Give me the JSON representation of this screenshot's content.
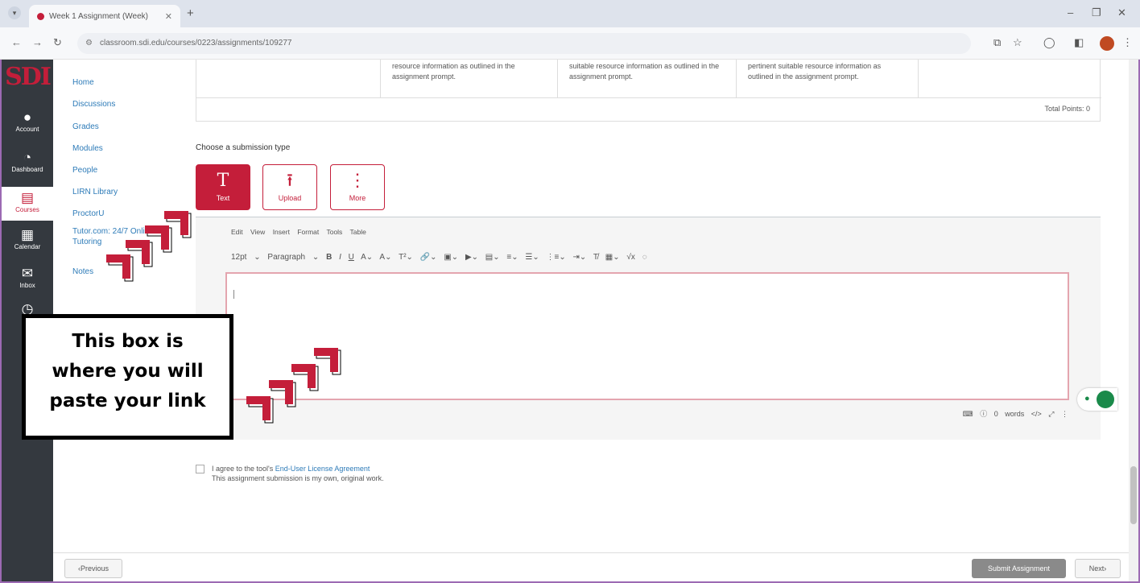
{
  "browser": {
    "tab_title": "Week 1 Assignment (Week)",
    "url": "classroom.sdi.edu/courses/0223/assignments/109277"
  },
  "global_nav": {
    "logo": "SDI",
    "items": [
      {
        "label": "Account",
        "icon": "user-icon"
      },
      {
        "label": "Dashboard",
        "icon": "dashboard-icon"
      },
      {
        "label": "Courses",
        "icon": "book-icon",
        "active": true
      },
      {
        "label": "Calendar",
        "icon": "calendar-icon"
      },
      {
        "label": "Inbox",
        "icon": "inbox-icon"
      }
    ]
  },
  "course_nav": {
    "links": [
      "Home",
      "Discussions",
      "Grades",
      "Modules",
      "People",
      "LIRN Library",
      "ProctorU",
      "Tutor.com: 24/7 Online",
      "Tutoring",
      "Notes"
    ]
  },
  "rubric": {
    "cells": [
      "resource information as outlined in the assignment prompt.",
      "suitable resource information as outlined in the assignment prompt.",
      "pertinent suitable resource information as outlined in the assignment prompt."
    ],
    "total": "Total Points: 0"
  },
  "submission": {
    "choose_label": "Choose a submission type",
    "types": [
      {
        "label": "Text",
        "icon": "text-icon",
        "active": true
      },
      {
        "label": "Upload",
        "icon": "upload-icon",
        "active": false
      },
      {
        "label": "More",
        "icon": "more-icon",
        "active": false
      }
    ]
  },
  "editor": {
    "menus": [
      "Edit",
      "View",
      "Insert",
      "Format",
      "Tools",
      "Table"
    ],
    "font_size": "12pt",
    "block_format": "Paragraph",
    "word_count": "0 words",
    "html_toggle": "</>"
  },
  "agreement": {
    "prefix": "I agree to the tool's",
    "link": "End-User License Agreement",
    "line2": "This assignment submission is my own, original work."
  },
  "footer": {
    "previous": "Previous",
    "submit": "Submit Assignment",
    "next": "Next"
  },
  "callout": {
    "line1": "This box is",
    "line2": "where you will",
    "line3": "paste your link"
  },
  "colors": {
    "accent": "#c41e3a",
    "link": "#2d7bb8",
    "nav_bg": "#34393f",
    "frame_border": "#9c6ab3"
  }
}
